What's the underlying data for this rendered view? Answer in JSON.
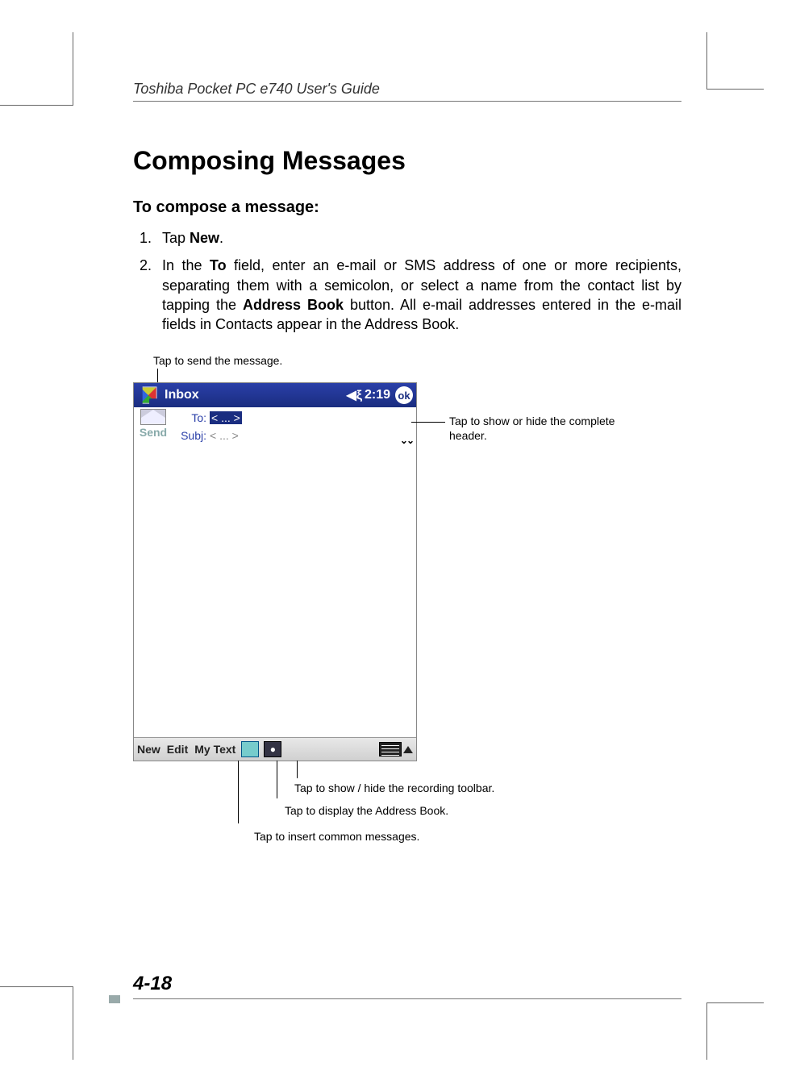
{
  "header": {
    "running_head": "Toshiba Pocket PC e740  User's Guide"
  },
  "section": {
    "title": "Composing Messages",
    "subhead": "To compose a message:",
    "steps": [
      {
        "pre": "Tap ",
        "bold": "New",
        "post": "."
      },
      {
        "pre": "In the ",
        "bold": "To",
        "mid": " field, enter an e-mail or SMS address of one or more recipients, separating them with a semicolon, or select a name from the contact list by tapping the ",
        "bold2": "Address Book",
        "post": " button. All e-mail addresses entered in the e-mail fields in Contacts appear in the Address Book."
      }
    ]
  },
  "callouts": {
    "send": "Tap to send the message.",
    "header_toggle": "Tap to show or hide the complete header.",
    "recording": "Tap to show / hide the recording toolbar.",
    "address_book": "Tap to display the Address Book.",
    "my_text": "Tap to insert common messages."
  },
  "device": {
    "titlebar": {
      "title": "Inbox",
      "time": "2:19",
      "ok": "ok"
    },
    "fields": {
      "send": "Send",
      "to_label": "To:",
      "to_value": "< ... >",
      "subj_label": "Subj:",
      "subj_value": "< ... >"
    },
    "bottombar": {
      "new": "New",
      "edit": "Edit",
      "mytext": "My Text"
    }
  },
  "footer": {
    "page": "4-18"
  }
}
